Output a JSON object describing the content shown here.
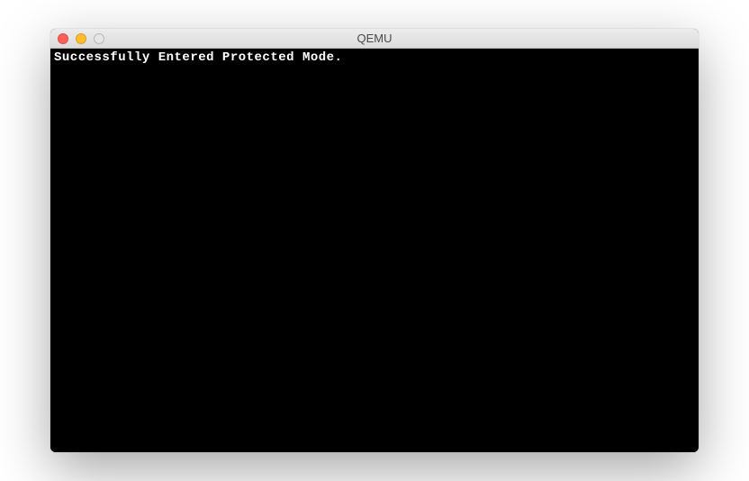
{
  "window": {
    "title": "QEMU"
  },
  "terminal": {
    "lines": [
      "Successfully Entered Protected Mode."
    ]
  }
}
